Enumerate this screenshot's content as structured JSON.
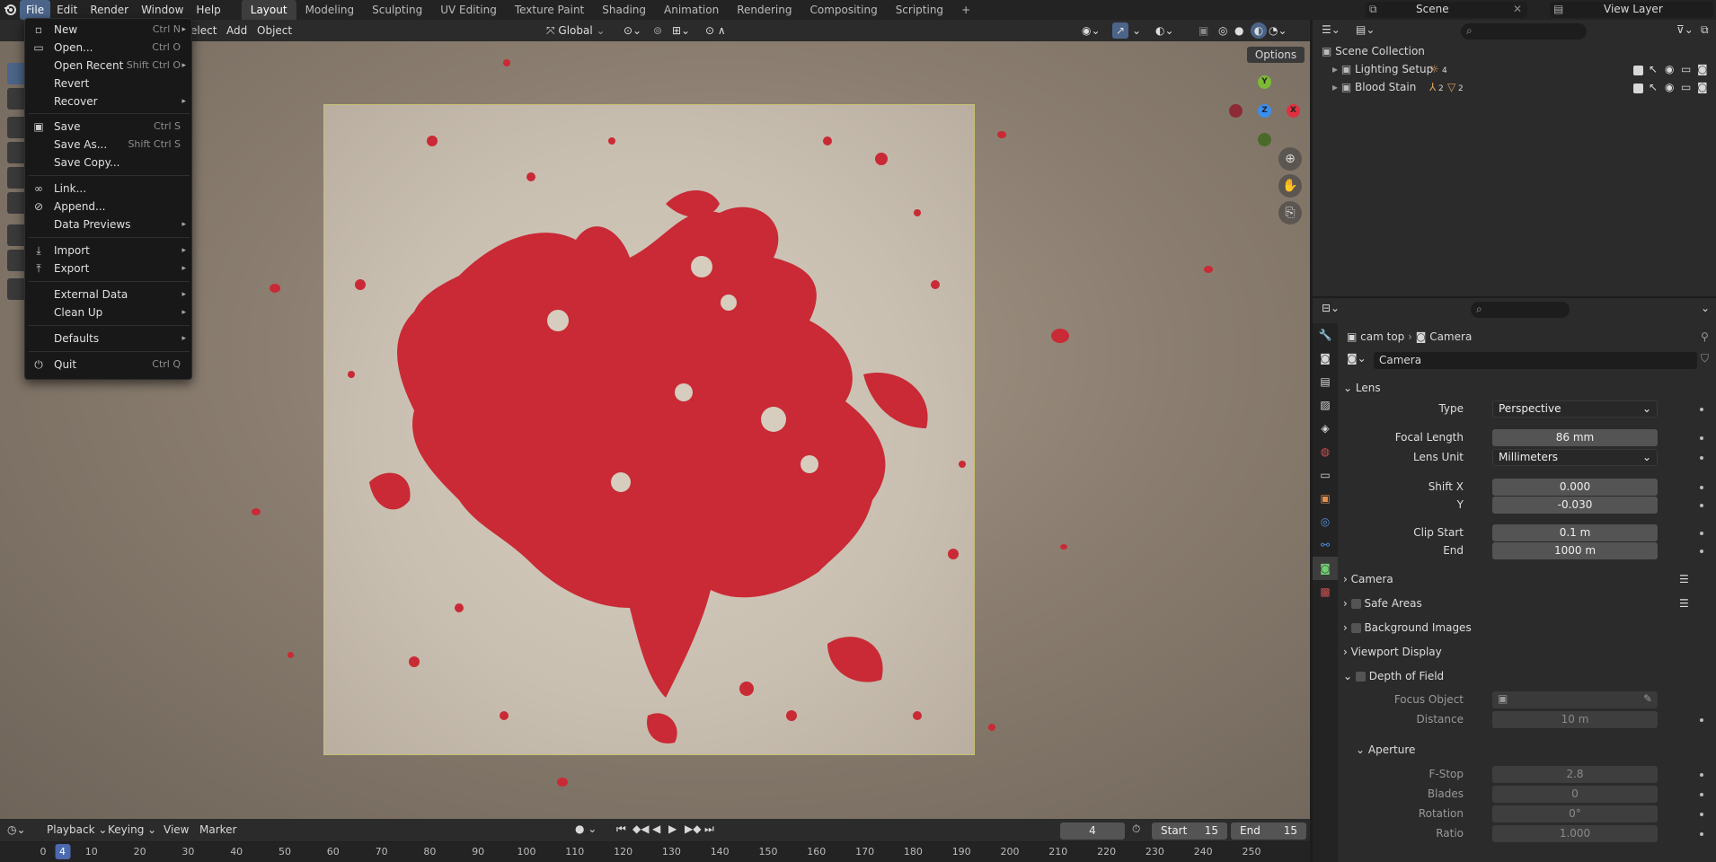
{
  "topbar": {
    "menus": [
      "File",
      "Edit",
      "Render",
      "Window",
      "Help"
    ],
    "workspaces": [
      "Layout",
      "Modeling",
      "Sculpting",
      "UV Editing",
      "Texture Paint",
      "Shading",
      "Animation",
      "Rendering",
      "Compositing",
      "Scripting"
    ],
    "add_tab": "+",
    "scene_label": "Scene",
    "view_layer_label": "View Layer"
  },
  "header": {
    "select": "elect",
    "add": "Add",
    "object": "Object",
    "transform_orientation": "Global",
    "options": "Options"
  },
  "file_menu": {
    "items": [
      {
        "label": "New",
        "shortcut": "Ctrl N",
        "arrow": "▸"
      },
      {
        "label": "Open...",
        "shortcut": "Ctrl O"
      },
      {
        "label": "Open Recent",
        "shortcut": "Shift Ctrl O",
        "arrow": "▸"
      },
      {
        "label": "Revert"
      },
      {
        "label": "Recover",
        "arrow": "▸"
      },
      {
        "label": "Save",
        "shortcut": "Ctrl S"
      },
      {
        "label": "Save As...",
        "shortcut": "Shift Ctrl S"
      },
      {
        "label": "Save Copy..."
      },
      {
        "label": "Link..."
      },
      {
        "label": "Append..."
      },
      {
        "label": "Data Previews",
        "arrow": "▸"
      },
      {
        "label": "Import",
        "arrow": "▸"
      },
      {
        "label": "Export",
        "arrow": "▸"
      },
      {
        "label": "External Data",
        "arrow": "▸"
      },
      {
        "label": "Clean Up",
        "arrow": "▸"
      },
      {
        "label": "Defaults",
        "arrow": "▸"
      },
      {
        "label": "Quit",
        "shortcut": "Ctrl Q"
      }
    ]
  },
  "outliner": {
    "root": "Scene Collection",
    "collections": [
      {
        "name": "Lighting Setup",
        "count": "4"
      },
      {
        "name": "Blood Stain",
        "count_a": "2",
        "count_b": "2"
      }
    ]
  },
  "properties": {
    "breadcrumb_object": "cam top",
    "breadcrumb_data": "Camera",
    "data_name": "Camera",
    "lens_panel": "Lens",
    "type_label": "Type",
    "type_value": "Perspective",
    "focal_label": "Focal Length",
    "focal_value": "86 mm",
    "lens_unit_label": "Lens Unit",
    "lens_unit_value": "Millimeters",
    "shift_x_label": "Shift X",
    "shift_x_value": "0.000",
    "shift_y_label": "Y",
    "shift_y_value": "-0.030",
    "clip_start_label": "Clip Start",
    "clip_start_value": "0.1 m",
    "clip_end_label": "End",
    "clip_end_value": "1000 m",
    "panels": [
      "Camera",
      "Safe Areas",
      "Background Images",
      "Viewport Display",
      "Depth of Field"
    ],
    "focus_object_label": "Focus Object",
    "distance_label": "Distance",
    "distance_value": "10 m",
    "aperture_panel": "Aperture",
    "fstop_label": "F-Stop",
    "fstop_value": "2.8",
    "blades_label": "Blades",
    "blades_value": "0",
    "rotation_label": "Rotation",
    "rotation_value": "0°",
    "ratio_label": "Ratio",
    "ratio_value": "1.000"
  },
  "timeline": {
    "playback": "Playback",
    "keying": "Keying",
    "view": "View",
    "marker": "Marker",
    "current_frame": "4",
    "start_label": "Start",
    "start_value": "15",
    "end_label": "End",
    "end_value": "15",
    "ruler": [
      "0",
      "10",
      "20",
      "30",
      "40",
      "50",
      "60",
      "70",
      "80",
      "90",
      "100",
      "110",
      "120",
      "130",
      "140",
      "150",
      "160",
      "170",
      "180",
      "190",
      "200",
      "210",
      "220",
      "230",
      "240",
      "250"
    ],
    "playhead": "4"
  },
  "colors": {
    "accent": "#4b6488",
    "blood": "#c92a35",
    "axis_x": "#e0303f",
    "axis_y": "#7dba35",
    "axis_z": "#3a8ef0"
  }
}
